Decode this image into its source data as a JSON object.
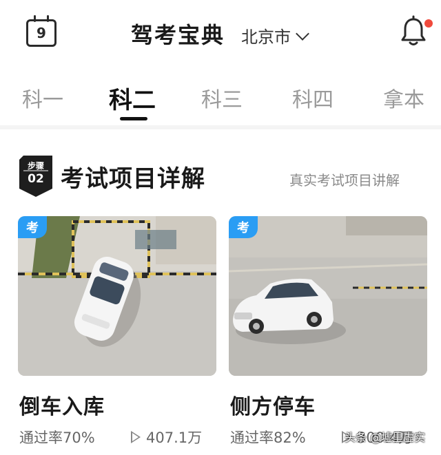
{
  "header": {
    "calendar_day": "9",
    "title": "驾考宝典",
    "city": "北京市"
  },
  "tabs": [
    {
      "label": "科一"
    },
    {
      "label": "科二"
    },
    {
      "label": "科三"
    },
    {
      "label": "科四"
    },
    {
      "label": "拿本"
    }
  ],
  "section": {
    "step_label": "步骤",
    "step_number": "02",
    "title": "考试项目详解",
    "link": "真实考试项目讲解"
  },
  "cards": [
    {
      "badge": "考",
      "title": "倒车入库",
      "pass_rate": "通过率70%",
      "views": "407.1万"
    },
    {
      "badge": "考",
      "title": "侧方停车",
      "pass_rate": "通过率82%",
      "views": "300.4万"
    }
  ],
  "watermark": "头条 @墟里虚实",
  "colors": {
    "accent_blue": "#2a9df4",
    "notification_red": "#f04a3c",
    "active_tab": "#111111",
    "inactive_tab": "#9a9a9a"
  }
}
